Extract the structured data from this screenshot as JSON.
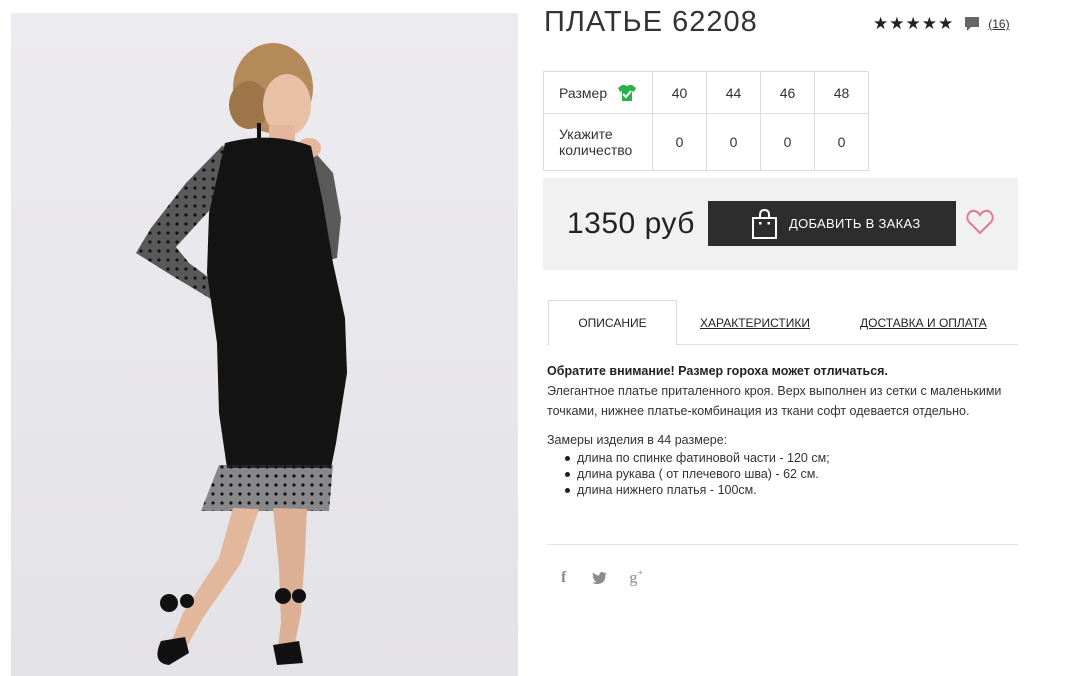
{
  "product": {
    "title": "ПЛАТЬЕ 62208",
    "rating_stars": 5,
    "review_count": "(16)"
  },
  "sizes": {
    "size_label": "Размер",
    "quantity_label_line1": "Укажите",
    "quantity_label_line2": "количество",
    "values": [
      "40",
      "44",
      "46",
      "48"
    ],
    "quantities": [
      "0",
      "0",
      "0",
      "0"
    ]
  },
  "purchase": {
    "price": "1350 руб",
    "add_button_label": "ДОБАВИТЬ В ЗАКАЗ"
  },
  "tabs": {
    "description": "ОПИСАНИЕ",
    "characteristics": "ХАРАКТЕРИСТИКИ",
    "delivery": "ДОСТАВКА И ОПЛАТА"
  },
  "description": {
    "notice": "Обратите внимание! Размер гороха может отличаться.",
    "body": "Элегантное платье приталенного кроя. Верх выполнен из сетки с маленькими точками, нижнее платье-комбинация из ткани софт одевается отдельно.",
    "measure_title": "Замеры изделия в 44 размере:",
    "measures": [
      "длина по спинке фатиновой части - 120 см;",
      "длина рукава ( от плечевого шва) - 62 см.",
      "длина нижнего платья - 100см."
    ]
  },
  "social": {
    "facebook": "f",
    "googleplus": "g"
  },
  "colors": {
    "button_bg": "#2d2d2d",
    "heart": "#e07b90",
    "size_icon": "#27b24a",
    "price_bar_bg": "#f1f1f1"
  }
}
